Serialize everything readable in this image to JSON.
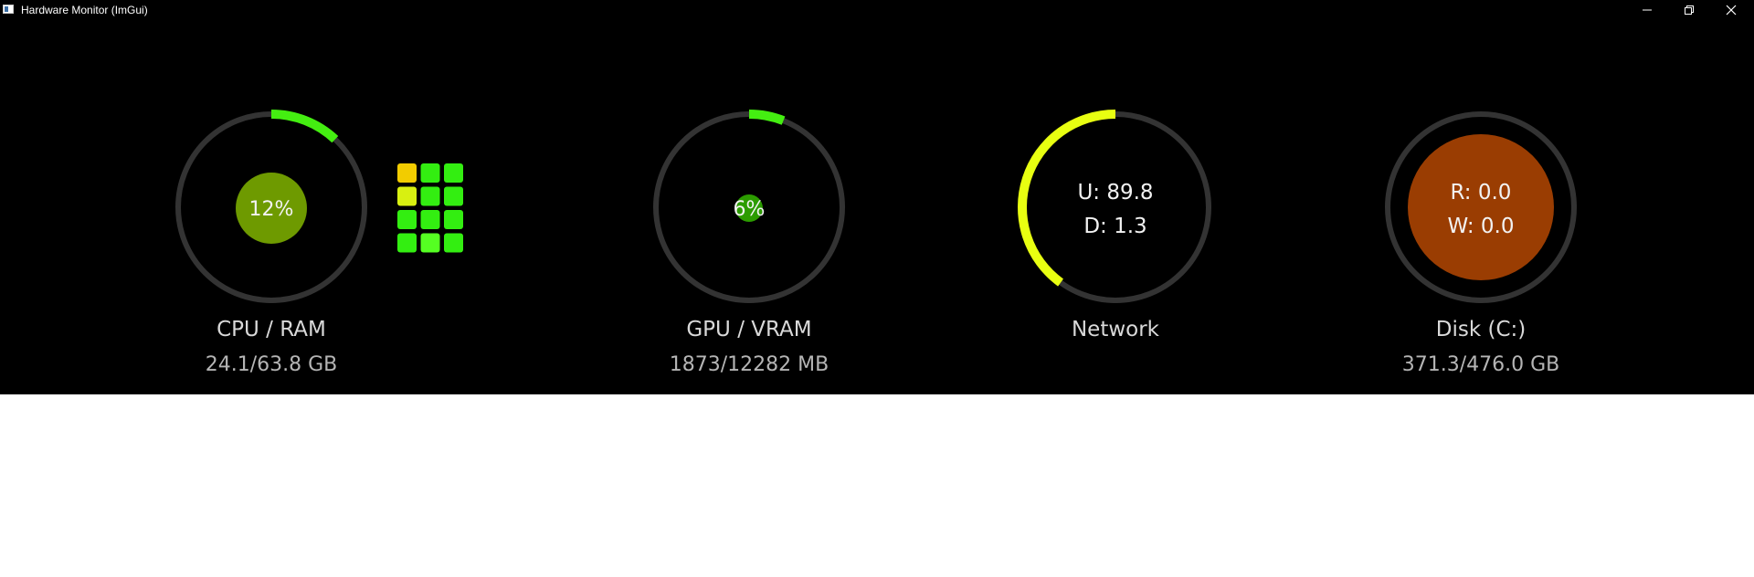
{
  "window": {
    "title": "Hardware Monitor (ImGui)"
  },
  "colors": {
    "background": "#000000",
    "ring_track": "#333333",
    "cpu_arc": "#44ee11",
    "cpu_center": "#6e9a00",
    "gpu_arc": "#44ee11",
    "gpu_center": "#2c9c00",
    "network_arc": "#e8ff11",
    "disk_center": "#9a3d02"
  },
  "cpu": {
    "percent_text": "12%",
    "usage": 0.12,
    "label": "CPU / RAM",
    "value": "24.1/63.8 GB",
    "core_colors": [
      "#f2cc00",
      "#33ee11",
      "#33ee11",
      "#d8f011",
      "#33ee11",
      "#33ee11",
      "#33ee11",
      "#33ee11",
      "#33ee11",
      "#33ee11",
      "#55ff22",
      "#33ee11"
    ]
  },
  "gpu": {
    "percent_text": "6%",
    "usage": 0.06,
    "label": "GPU / VRAM",
    "value": "1873/12282 MB"
  },
  "network": {
    "upload_text": "U: 89.8",
    "download_text": "D: 1.3",
    "level": 0.4,
    "label": "Network"
  },
  "disk": {
    "read_text": "R: 0.0",
    "write_text": "W: 0.0",
    "label": "Disk (C:)",
    "value": "371.3/476.0 GB"
  }
}
